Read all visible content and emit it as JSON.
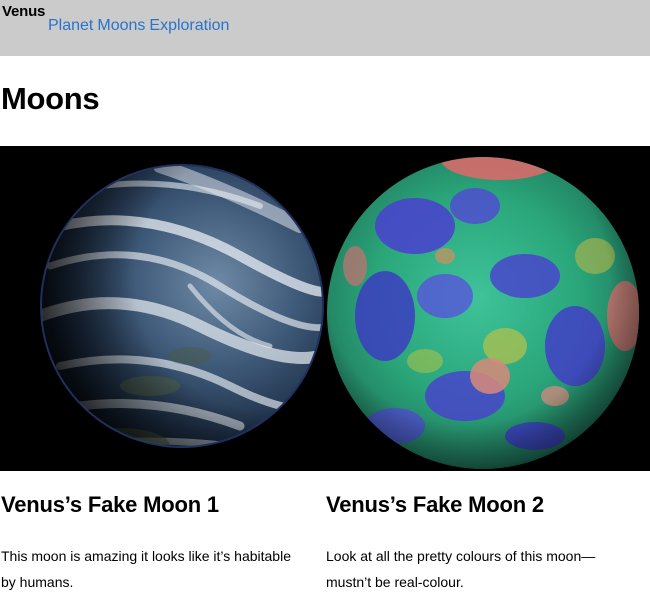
{
  "header": {
    "site_title": "Venus",
    "nav": [
      "Planet",
      "Moons",
      "Exploration"
    ]
  },
  "page": {
    "title": "Moons"
  },
  "moons": [
    {
      "title": "Venus’s Fake Moon 1",
      "description": "This moon is amazing it looks like it’s habitable by humans."
    },
    {
      "title": "Venus’s Fake Moon 2",
      "description": "Look at all the pretty colours of this moon—mustn’t be real-colour."
    }
  ],
  "colors": {
    "header_bg": "#cbcbcb",
    "link": "#2a73c9"
  }
}
